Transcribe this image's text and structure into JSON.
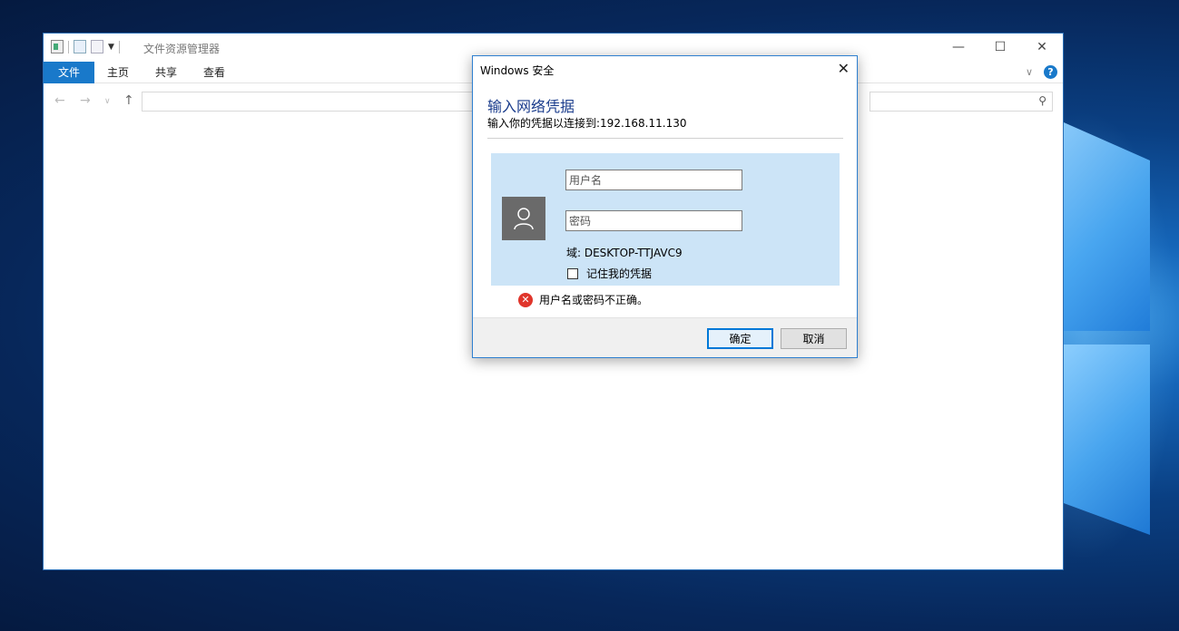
{
  "explorer": {
    "title": "文件资源管理器",
    "ribbon_tabs": [
      "文件",
      "主页",
      "共享",
      "查看"
    ],
    "window_buttons": {
      "minimize": "—",
      "maximize": "☐",
      "close": "✕"
    },
    "help_glyph": "?"
  },
  "dialog": {
    "title": "Windows 安全",
    "heading": "输入网络凭据",
    "subtitle": "输入你的凭据以连接到:192.168.11.130",
    "username_placeholder": "用户名",
    "password_placeholder": "密码",
    "domain": "域: DESKTOP-TTJAVC9",
    "remember_label": "记住我的凭据",
    "remember_checked": false,
    "error_text": "用户名或密码不正确。",
    "ok_label": "确定",
    "cancel_label": "取消"
  },
  "colors": {
    "accent": "#1979ca",
    "dialog_heading": "#1a3c8c",
    "credential_panel": "#cce4f7",
    "error": "#e0352b"
  },
  "icons": [
    "properties-icon",
    "checkmark-icon",
    "new-folder-icon",
    "qat-dropdown-icon",
    "minimize-icon",
    "maximize-icon",
    "close-icon",
    "ribbon-expand-icon",
    "help-icon",
    "back-arrow-icon",
    "forward-arrow-icon",
    "recent-dropdown-icon",
    "up-arrow-icon",
    "search-icon",
    "user-avatar-icon",
    "error-icon"
  ]
}
